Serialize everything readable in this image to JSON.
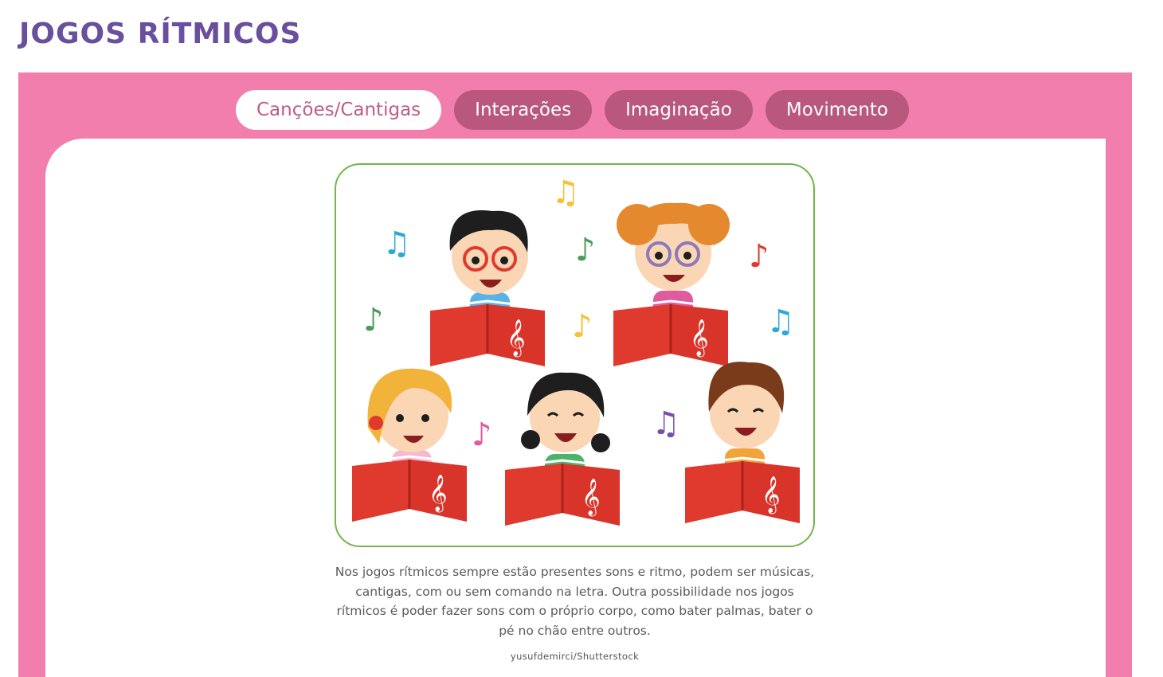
{
  "header": {
    "title": "JOGOS RÍTMICOS"
  },
  "tabs": [
    {
      "label": "Canções/Cantigas",
      "active": true
    },
    {
      "label": "Interações",
      "active": false
    },
    {
      "label": "Imaginação",
      "active": false
    },
    {
      "label": "Movimento",
      "active": false
    }
  ],
  "content": {
    "description": "Nos jogos rítmicos sempre estão presentes sons e ritmo, podem ser músicas, cantigas, com ou sem comando na letra. Outra possibilidade nos jogos rítmicos é poder fazer sons com o próprio corpo, como bater palmas, bater o pé no chão entre outros.",
    "credit": "yusufdemirci/Shutterstock"
  },
  "colors": {
    "title": "#6a4f9c",
    "frame": "#f17ead",
    "tab_inactive": "#b9577d",
    "tab_active_text": "#bf5b86",
    "image_border": "#75b449"
  }
}
